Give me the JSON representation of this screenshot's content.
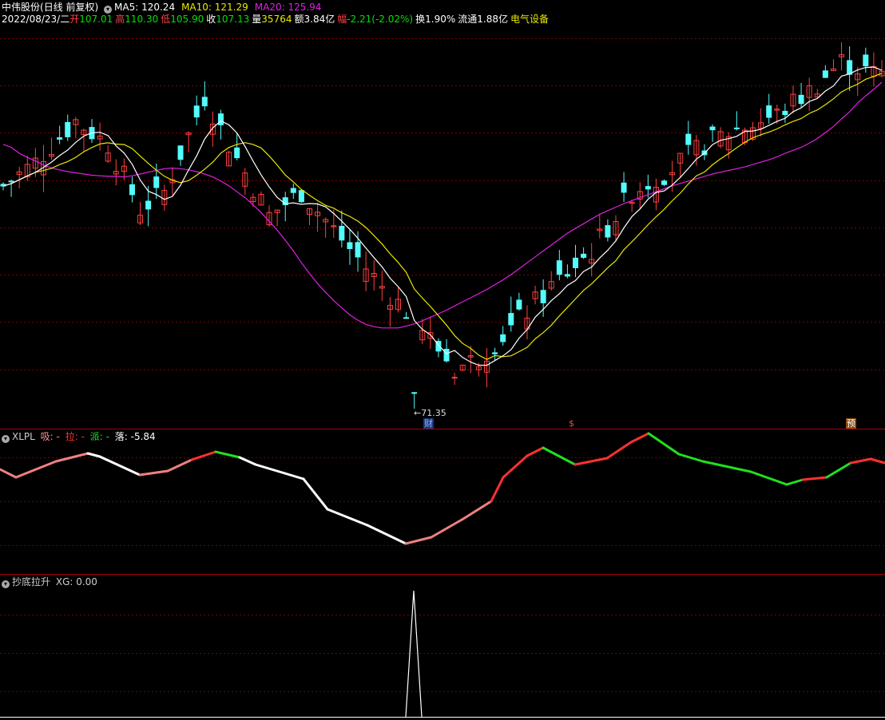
{
  "stock": {
    "name": "中伟股份",
    "mode": "(日线 前复权)",
    "date": "2022/08/23/二"
  },
  "ma": {
    "ma5": "MA5: 120.24",
    "ma10": "MA10: 121.29",
    "ma20": "MA20: 125.94"
  },
  "quote": {
    "open_l": "开",
    "open_v": "107.01",
    "high_l": "高",
    "high_v": "110.30",
    "low_l": "低",
    "low_v": "105.90",
    "close_l": "收",
    "close_v": "107.13",
    "vol_l": "量",
    "vol_v": "35764",
    "amt_l": "额",
    "amt_v": "3.84亿",
    "chg_l": "幅",
    "chg_v": "-2.21(-2.02%)",
    "turn_l": "换",
    "turn_v": "1.90%",
    "float_l": "流通",
    "float_v": "1.88亿",
    "sector": "电气设备"
  },
  "low_marker": "←71.35",
  "event_markers": {
    "cai": "财",
    "dollar": "$",
    "yu": "预"
  },
  "xlpl": {
    "name": "XLPL",
    "xi": "吸: -",
    "la": "拉: -",
    "pai": "派: -",
    "luo": "落: -5.84"
  },
  "cdls": {
    "name": "抄底拉升",
    "xg": "XG: 0.00"
  },
  "colors": {
    "up": "#ff4040",
    "down": "#54fcfc",
    "ma5": "#ffffff",
    "ma10": "#e8e800",
    "ma20": "#e020e0",
    "grid": "#7a0000"
  },
  "chart_data": {
    "type": "candlestick",
    "price_range": [
      71.35,
      135
    ],
    "ma20": [
      116,
      115.5,
      114.5,
      113.8,
      113.2,
      112.5,
      112,
      111.7,
      111.4,
      111.2,
      111,
      110.8,
      110.7,
      110.6,
      110.6,
      110.5,
      110.7,
      111,
      111.3,
      111.6,
      111.9,
      112,
      111.9,
      111.7,
      111.4,
      111,
      110.5,
      109.8,
      109,
      108,
      107,
      105.8,
      104.5,
      103,
      101.5,
      99.8,
      98,
      96,
      94.2,
      92.5,
      91,
      89.6,
      88.4,
      87.2,
      86.3,
      85.6,
      85.2,
      85,
      85,
      85,
      85.3,
      85.7,
      86.2,
      86.8,
      87.4,
      88,
      88.7,
      89.4,
      90.1,
      90.8,
      91.5,
      92.3,
      93.1,
      94,
      95,
      96,
      97,
      98,
      99,
      100,
      101,
      101.8,
      102.6,
      103.4,
      104.2,
      104.8,
      105.4,
      106,
      106.5,
      107,
      107.5,
      108,
      108.5,
      109,
      109.4,
      109.8,
      110.2,
      110.6,
      111,
      111.3,
      111.6,
      111.9,
      112.2,
      112.6,
      113,
      113.4,
      113.9,
      114.5,
      115,
      115.5,
      116.2,
      117,
      118,
      119,
      120.3,
      121.5,
      123,
      124.2,
      125.3,
      126.5
    ]
  }
}
